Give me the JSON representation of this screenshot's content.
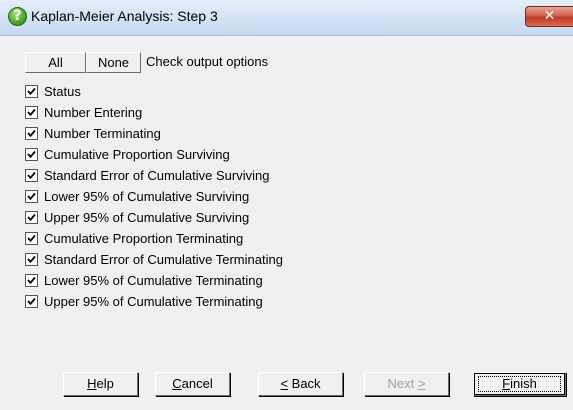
{
  "window": {
    "title": "Kaplan-Meier Analysis: Step 3",
    "icon": "question-icon",
    "close_glyph": "✕"
  },
  "options_bar": {
    "all_label": "All",
    "none_label": "None",
    "caption": "Check output options"
  },
  "checkboxes": [
    {
      "label": "Status",
      "checked": true
    },
    {
      "label": "Number Entering",
      "checked": true
    },
    {
      "label": "Number Terminating",
      "checked": true
    },
    {
      "label": "Cumulative Proportion Surviving",
      "checked": true
    },
    {
      "label": "Standard Error of Cumulative Surviving",
      "checked": true
    },
    {
      "label": "Lower 95% of Cumulative Surviving",
      "checked": true
    },
    {
      "label": "Upper 95% of Cumulative Surviving",
      "checked": true
    },
    {
      "label": "Cumulative Proportion Terminating",
      "checked": true
    },
    {
      "label": "Standard Error of Cumulative Terminating",
      "checked": true
    },
    {
      "label": "Lower 95% of Cumulative Terminating",
      "checked": true
    },
    {
      "label": "Upper 95% of Cumulative Terminating",
      "checked": true
    }
  ],
  "buttons": {
    "help": {
      "mnemonic": "H",
      "rest": "elp"
    },
    "cancel": {
      "mnemonic": "C",
      "rest": "ancel"
    },
    "back": {
      "mnemonic": "<",
      "rest": " Back"
    },
    "next": {
      "label": "Next ",
      "mnemonic": ">",
      "enabled": false
    },
    "finish": {
      "mnemonic": "F",
      "rest": "inish",
      "default": true
    }
  },
  "colors": {
    "client_bg": "#f0f0f0",
    "close_button": "#c0392b",
    "disabled_text": "#a0a0a0"
  }
}
